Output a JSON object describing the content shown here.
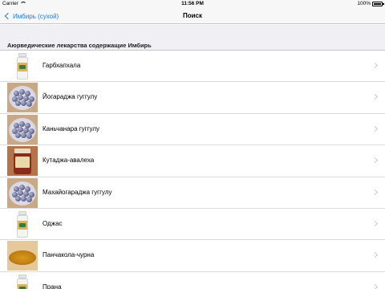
{
  "status": {
    "carrier": "Carrier",
    "time": "11:56 PM",
    "battery": "100%"
  },
  "nav": {
    "back_label": "Имбирь (сухой)",
    "title": "Поиск"
  },
  "section": {
    "header": "Аюрведические лекарства содержащие Имбирь"
  },
  "items": [
    {
      "label": "Гарбхапхала",
      "thumb": "bottle"
    },
    {
      "label": "Йогараджа гуггулу",
      "thumb": "pills"
    },
    {
      "label": "Каньчанара гуггулу",
      "thumb": "pills"
    },
    {
      "label": "Кутаджа-авалеха",
      "thumb": "jar"
    },
    {
      "label": "Махайогараджа гуггулу",
      "thumb": "pills"
    },
    {
      "label": "Оджас",
      "thumb": "bottle"
    },
    {
      "label": "Панчакола-чурна",
      "thumb": "powder"
    },
    {
      "label": "Прана",
      "thumb": "bottle"
    }
  ],
  "colors": {
    "accent": "#1a7cf5",
    "background": "#efeff4"
  }
}
